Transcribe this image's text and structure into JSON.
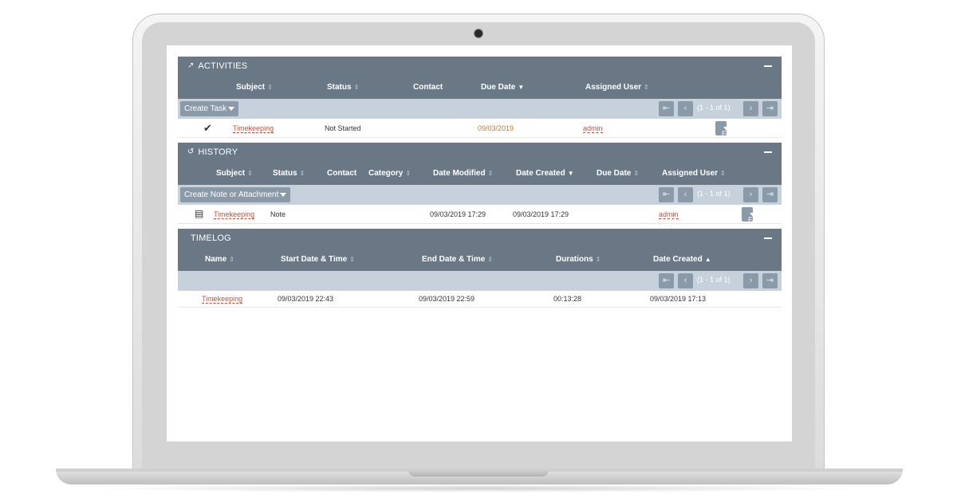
{
  "activities": {
    "title": "ACTIVITIES",
    "columns": [
      "Subject",
      "Status",
      "Contact",
      "Due Date",
      "Assigned User"
    ],
    "create_button": "Create Task",
    "pager_info": "(1 - 1 of 1)",
    "row": {
      "subject": "Timekeeping",
      "status": "Not Started",
      "due_date": "09/03/2019",
      "assigned_user": "admin",
      "edit": "Edit"
    }
  },
  "history": {
    "title": "HISTORY",
    "columns": [
      "Subject",
      "Status",
      "Contact",
      "Category",
      "Date Modified",
      "Date Created",
      "Due Date",
      "Assigned User"
    ],
    "create_button": "Create Note or Attachment",
    "pager_info": "(1 - 1 of 1)",
    "row": {
      "subject": "Timekeeping",
      "status": "Note",
      "date_modified": "09/03/2019 17:29",
      "date_created": "09/03/2019 17:29",
      "assigned_user": "admin",
      "edit": "Edit"
    }
  },
  "timelog": {
    "title": "TIMELOG",
    "columns": [
      "Name",
      "Start Date & Time",
      "End Date & Time",
      "Durations",
      "Date Created"
    ],
    "pager_info": "(1 - 1 of 1)",
    "row": {
      "name": "Timekeeping",
      "start": "09/03/2019 22:43",
      "end": "09/03/2019 22:59",
      "duration": "00:13:28",
      "date_created": "09/03/2019 17:13"
    }
  },
  "icons": {
    "activities": "activity-chart-icon",
    "history": "history-clock-icon",
    "task": "task-check-icon",
    "note": "calendar-note-icon"
  },
  "colors": {
    "header": "#6a7886",
    "toolbar": "#c6d1db",
    "button": "#8b9aa8",
    "link": "#d04a35"
  }
}
